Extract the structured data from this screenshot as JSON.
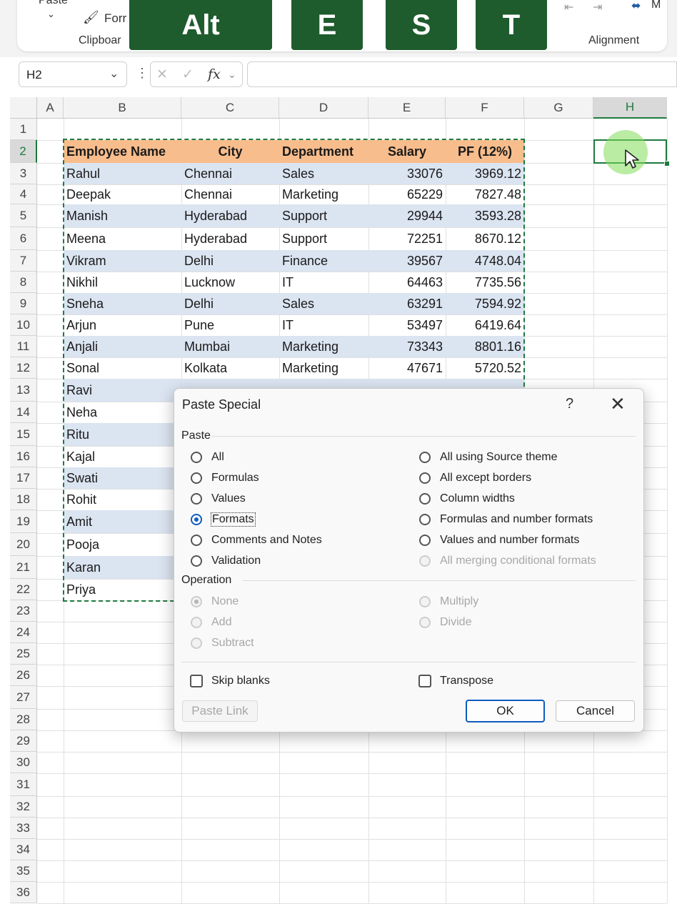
{
  "ribbon": {
    "paste_label": "Paste",
    "format_painter_label": "Forr",
    "clipboard_label": "Clipboar",
    "alignment_label": "Alignment",
    "merge_label": "M",
    "keytips": [
      "Alt",
      "E",
      "S",
      "T"
    ]
  },
  "formula_bar": {
    "name_box": "H2",
    "formula": ""
  },
  "columns": [
    "A",
    "B",
    "C",
    "D",
    "E",
    "F",
    "G",
    "H"
  ],
  "rows": [
    "1",
    "2",
    "3",
    "4",
    "5",
    "6",
    "7",
    "8",
    "9",
    "10",
    "11",
    "12",
    "13",
    "14",
    "15",
    "16",
    "17",
    "18",
    "19",
    "20",
    "21",
    "22",
    "23",
    "24",
    "25",
    "26",
    "27",
    "28",
    "29",
    "30",
    "31",
    "32",
    "33",
    "34",
    "35",
    "36"
  ],
  "table": {
    "headers": [
      "Employee Name",
      "City",
      "Department",
      "Salary",
      "PF (12%)"
    ],
    "rows": [
      [
        "Rahul",
        "Chennai",
        "Sales",
        "33076",
        "3969.12"
      ],
      [
        "Deepak",
        "Chennai",
        "Marketing",
        "65229",
        "7827.48"
      ],
      [
        "Manish",
        "Hyderabad",
        "Support",
        "29944",
        "3593.28"
      ],
      [
        "Meena",
        "Hyderabad",
        "Support",
        "72251",
        "8670.12"
      ],
      [
        "Vikram",
        "Delhi",
        "Finance",
        "39567",
        "4748.04"
      ],
      [
        "Nikhil",
        "Lucknow",
        "IT",
        "64463",
        "7735.56"
      ],
      [
        "Sneha",
        "Delhi",
        "Sales",
        "63291",
        "7594.92"
      ],
      [
        "Arjun",
        "Pune",
        "IT",
        "53497",
        "6419.64"
      ],
      [
        "Anjali",
        "Mumbai",
        "Marketing",
        "73343",
        "8801.16"
      ],
      [
        "Sonal",
        "Kolkata",
        "Marketing",
        "47671",
        "5720.52"
      ],
      [
        "Ravi",
        "",
        "",
        "",
        ""
      ],
      [
        "Neha",
        "",
        "",
        "",
        ""
      ],
      [
        "Ritu",
        "",
        "",
        "",
        ""
      ],
      [
        "Kajal",
        "",
        "",
        "",
        ""
      ],
      [
        "Swati",
        "",
        "",
        "",
        ""
      ],
      [
        "Rohit",
        "",
        "",
        "",
        ""
      ],
      [
        "Amit",
        "",
        "",
        "",
        ""
      ],
      [
        "Pooja",
        "",
        "",
        "",
        ""
      ],
      [
        "Karan",
        "",
        "",
        "",
        ""
      ],
      [
        "Priya",
        "",
        "",
        "",
        ""
      ]
    ]
  },
  "dialog": {
    "title": "Paste Special",
    "help": "?",
    "close": "✕",
    "paste_group": "Paste",
    "paste_left": [
      "All",
      "Formulas",
      "Values",
      "Formats",
      "Comments and Notes",
      "Validation"
    ],
    "paste_right": [
      "All using Source theme",
      "All except borders",
      "Column widths",
      "Formulas and number formats",
      "Values and number formats",
      "All merging conditional formats"
    ],
    "selected_paste": "Formats",
    "operation_group": "Operation",
    "operation_left": [
      "None",
      "Add",
      "Subtract"
    ],
    "operation_right": [
      "Multiply",
      "Divide"
    ],
    "skip_blanks": "Skip blanks",
    "transpose": "Transpose",
    "paste_link": "Paste Link",
    "ok": "OK",
    "cancel": "Cancel"
  },
  "colors": {
    "header_fill": "#f8bd8c",
    "band_fill": "#dbe4f1",
    "keytip_bg": "#1e5b2d",
    "selection": "#1e7a3e",
    "accent": "#0f5cc0"
  }
}
